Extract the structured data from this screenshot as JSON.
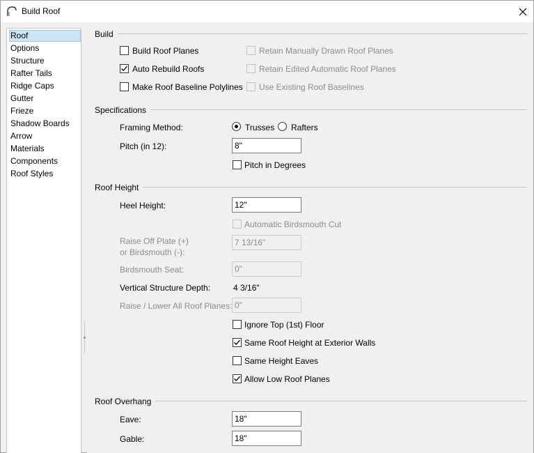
{
  "window": {
    "title": "Build Roof"
  },
  "nav": {
    "items": [
      {
        "label": "Roof"
      },
      {
        "label": "Options"
      },
      {
        "label": "Structure"
      },
      {
        "label": "Rafter Tails"
      },
      {
        "label": "Ridge Caps"
      },
      {
        "label": "Gutter"
      },
      {
        "label": "Frieze"
      },
      {
        "label": "Shadow Boards"
      },
      {
        "label": "Arrow"
      },
      {
        "label": "Materials"
      },
      {
        "label": "Components"
      },
      {
        "label": "Roof Styles"
      }
    ],
    "selected": "Roof"
  },
  "build": {
    "title": "Build",
    "build_roof_planes": {
      "label": "Build Roof Planes",
      "checked": false
    },
    "auto_rebuild_roofs": {
      "label": "Auto Rebuild Roofs",
      "checked": true
    },
    "make_baseline_polylines": {
      "label": "Make Roof Baseline Polylines",
      "checked": false
    },
    "retain_manual": {
      "label": "Retain Manually Drawn Roof Planes",
      "checked": false,
      "disabled": true
    },
    "retain_edited": {
      "label": "Retain Edited Automatic Roof Planes",
      "checked": false,
      "disabled": true
    },
    "use_existing": {
      "label": "Use Existing Roof Baselines",
      "checked": false,
      "disabled": true
    }
  },
  "specifications": {
    "title": "Specifications",
    "framing_label": "Framing Method:",
    "trusses_label": "Trusses",
    "rafters_label": "Rafters",
    "framing_selected": "Trusses",
    "pitch_label": "Pitch (in 12):",
    "pitch_value": "8\"",
    "pitch_in_degrees": {
      "label": "Pitch in Degrees",
      "checked": false
    }
  },
  "roof_height": {
    "title": "Roof Height",
    "heel_label": "Heel Height:",
    "heel_value": "12\"",
    "auto_birdsmouth": {
      "label": "Automatic Birdsmouth Cut",
      "checked": false,
      "disabled": true
    },
    "raise_off_label_1": "Raise Off Plate (+)",
    "raise_off_label_2": "or Birdsmouth (-):",
    "raise_off_value": "7 13/16\"",
    "birdsmouth_seat_label": "Birdsmouth Seat:",
    "birdsmouth_seat_value": "0\"",
    "vertical_depth_label": "Vertical Structure Depth:",
    "vertical_depth_value": "4 3/16\"",
    "raise_lower_label": "Raise / Lower All Roof Planes:",
    "raise_lower_value": "0\"",
    "ignore_top_floor": {
      "label": "Ignore Top (1st) Floor",
      "checked": false
    },
    "same_roof_height": {
      "label": "Same Roof Height at Exterior Walls",
      "checked": true
    },
    "same_height_eaves": {
      "label": "Same Height Eaves",
      "checked": false
    },
    "allow_low_planes": {
      "label": "Allow Low Roof Planes",
      "checked": true
    }
  },
  "roof_overhang": {
    "title": "Roof Overhang",
    "eave_label": "Eave:",
    "eave_value": "18\"",
    "gable_label": "Gable:",
    "gable_value": "18\""
  }
}
